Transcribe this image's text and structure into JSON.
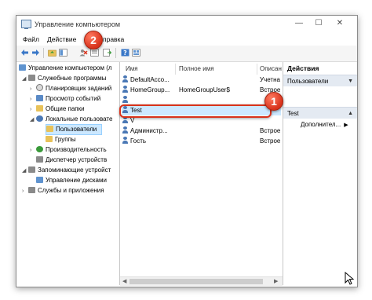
{
  "window": {
    "title": "Управление компьютером",
    "controls": {
      "minimize": "—",
      "maximize": "☐",
      "close": "✕"
    }
  },
  "menu": [
    {
      "label": "Файл"
    },
    {
      "label": "Действие"
    },
    {
      "label": "правка"
    }
  ],
  "tree": [
    {
      "label": "Управление компьютером (л",
      "arrow": ""
    },
    {
      "label": "Служебные программы",
      "arrow": "◢"
    },
    {
      "label": "Планировщик заданий",
      "arrow": "›"
    },
    {
      "label": "Просмотр событий",
      "arrow": "›"
    },
    {
      "label": "Общие папки",
      "arrow": "›"
    },
    {
      "label": "Локальные пользовате",
      "arrow": "◢"
    },
    {
      "label": "Пользователи",
      "arrow": ""
    },
    {
      "label": "Группы",
      "arrow": ""
    },
    {
      "label": "Производительность",
      "arrow": "›"
    },
    {
      "label": "Диспетчер устройств",
      "arrow": ""
    },
    {
      "label": "Запоминающие устройст",
      "arrow": "◢"
    },
    {
      "label": "Управление дисками",
      "arrow": ""
    },
    {
      "label": "Службы и приложения",
      "arrow": "›"
    }
  ],
  "list": {
    "columns": [
      "Имя",
      "Полное имя",
      "Описан"
    ],
    "rows": [
      {
        "name": "DefaultAcco...",
        "fullname": "",
        "desc": "Учетна"
      },
      {
        "name": "HomeGroup...",
        "fullname": "HomeGroupUser$",
        "desc": "Встрое"
      },
      {
        "name": "",
        "fullname": "",
        "desc": ""
      },
      {
        "name": "Test",
        "fullname": "",
        "desc": ""
      },
      {
        "name": "V",
        "fullname": "",
        "desc": ""
      },
      {
        "name": "Администр...",
        "fullname": "",
        "desc": "Встрое"
      },
      {
        "name": "Гость",
        "fullname": "",
        "desc": "Встрое"
      }
    ]
  },
  "actions": {
    "header": "Действия",
    "section1": "Пользователи",
    "section2": "Test",
    "more": "Дополнител..."
  },
  "badges": {
    "one": "1",
    "two": "2"
  },
  "colors": {
    "badge": "#d8321b",
    "selection": "#cce8ff",
    "action_bar": "#e4eaf2"
  }
}
